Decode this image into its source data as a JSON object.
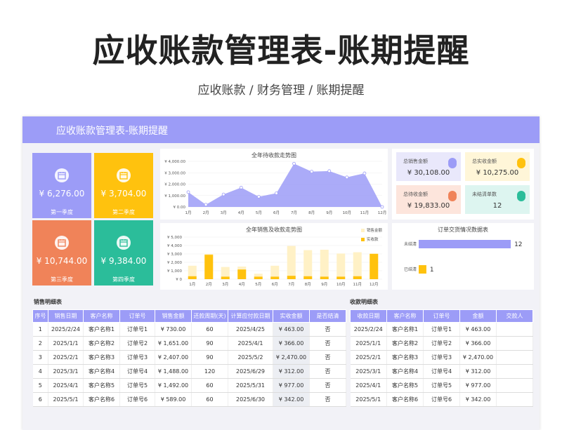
{
  "title": "应收账款管理表-账期提醒",
  "subtitle": "应收账款 / 财务管理 / 账期提醒",
  "banner_title": "应收账款管理表-账期提醒",
  "colors": {
    "accent": "#9c9cf7",
    "yellow": "#ffc20e",
    "orange": "#f08359",
    "teal": "#2bbd9a"
  },
  "quarters": [
    {
      "amount": "¥ 6,276.00",
      "label": "第一季度",
      "color": "#9c9cf7",
      "icon": "calendar-icon"
    },
    {
      "amount": "¥ 3,704.00",
      "label": "第二季度",
      "color": "#ffc20e",
      "icon": "calendar-icon"
    },
    {
      "amount": "¥ 10,744.00",
      "label": "第三季度",
      "color": "#f08359",
      "icon": "calendar-icon"
    },
    {
      "amount": "¥ 9,384.00",
      "label": "第四季度",
      "color": "#2bbd9a",
      "icon": "calendar-icon"
    }
  ],
  "kpis": [
    {
      "label": "总销售金额",
      "value": "¥ 30,108.00",
      "bg": "#e9e8fb",
      "coin": "#9c9cf7",
      "icon": "coins-icon"
    },
    {
      "label": "总实收金额",
      "value": "¥ 10,275.00",
      "bg": "#fff6d8",
      "coin": "#ffc20e",
      "icon": "coins-icon"
    },
    {
      "label": "总待收金额",
      "value": "¥ 19,833.00",
      "bg": "#fde5dc",
      "coin": "#f08359",
      "icon": "coins-icon"
    },
    {
      "label": "未结清单数",
      "value": "12",
      "bg": "#ddf5f0",
      "coin": "#2bbd9a",
      "icon": "coins-icon"
    }
  ],
  "chart_data": [
    {
      "type": "area",
      "title": "全年待收款走势图",
      "categories": [
        "1月",
        "2月",
        "3月",
        "4月",
        "5月",
        "6月",
        "7月",
        "8月",
        "9月",
        "10月",
        "11月",
        "12月"
      ],
      "yticks": [
        "¥ 4,000.00",
        "¥ 3,000.00",
        "¥ 2,000.00",
        "¥ 1,000.00",
        "¥ 0.00"
      ],
      "ylim": [
        0,
        4000
      ],
      "values": [
        1300,
        200,
        1100,
        1700,
        900,
        1200,
        3800,
        3100,
        3150,
        2600,
        2950,
        0
      ],
      "color": "#9c9cf7"
    },
    {
      "type": "bar",
      "title": "全年销售及收款走势图",
      "categories": [
        "1月",
        "2月",
        "3月",
        "4月",
        "5月",
        "6月",
        "7月",
        "8月",
        "9月",
        "10月",
        "11月",
        "12月"
      ],
      "yticks": [
        "¥ 5,000",
        "¥ 4,000",
        "¥ 3,000",
        "¥ 2,000",
        "¥ 1,000",
        "¥ 0"
      ],
      "ylim": [
        0,
        5000
      ],
      "series": [
        {
          "name": "销售金额",
          "values": [
            1600,
            3000,
            1450,
            1500,
            650,
            1600,
            3950,
            3450,
            3500,
            3050,
            3200,
            3100
          ],
          "color": "#fff1c6"
        },
        {
          "name": "实收款",
          "values": [
            350,
            2900,
            300,
            1150,
            300,
            300,
            400,
            350,
            300,
            300,
            350,
            3000
          ],
          "color": "#ffc20e"
        }
      ]
    },
    {
      "type": "bar",
      "title": "订单交货情况数据表",
      "categories": [
        "未结清",
        "已结清"
      ],
      "values": [
        12,
        1
      ],
      "xlim": [
        0,
        13
      ],
      "colors": [
        "#9c9cf7",
        "#ffc20e"
      ]
    }
  ],
  "sales_table": {
    "title": "销售明细表",
    "headers": [
      "序号",
      "销售日期",
      "客户名称",
      "订单号",
      "销售金额",
      "还款周期(天)",
      "计算应付款日期",
      "实收金额",
      "是否结清"
    ],
    "rows": [
      [
        "1",
        "2025/2/24",
        "客户名称1",
        "订单号1",
        "¥ 730.00",
        "60",
        "2025/4/25",
        "¥ 463.00",
        "否"
      ],
      [
        "2",
        "2025/1/1",
        "客户名称2",
        "订单号2",
        "¥ 1,651.00",
        "90",
        "2025/4/1",
        "¥ 366.00",
        "否"
      ],
      [
        "3",
        "2025/2/1",
        "客户名称3",
        "订单号3",
        "¥ 2,407.00",
        "90",
        "2025/5/2",
        "¥ 2,470.00",
        "否"
      ],
      [
        "4",
        "2025/3/1",
        "客户名称4",
        "订单号4",
        "¥ 1,488.00",
        "120",
        "2025/6/29",
        "¥ 312.00",
        "否"
      ],
      [
        "5",
        "2025/4/1",
        "客户名称5",
        "订单号5",
        "¥ 1,492.00",
        "60",
        "2025/5/31",
        "¥ 977.00",
        "否"
      ],
      [
        "6",
        "2025/5/1",
        "客户名称6",
        "订单号6",
        "¥ 589.00",
        "60",
        "2025/6/30",
        "¥ 342.00",
        "否"
      ]
    ]
  },
  "receipt_table": {
    "title": "收款明细表",
    "headers": [
      "收款日期",
      "客户名称",
      "订单号",
      "金额",
      "交款人"
    ],
    "rows": [
      [
        "2025/2/24",
        "客户名称1",
        "订单号1",
        "¥ 463.00",
        ""
      ],
      [
        "2025/1/1",
        "客户名称2",
        "订单号2",
        "¥ 366.00",
        ""
      ],
      [
        "2025/2/1",
        "客户名称3",
        "订单号3",
        "¥ 2,470.00",
        ""
      ],
      [
        "2025/3/1",
        "客户名称4",
        "订单号4",
        "¥ 312.00",
        ""
      ],
      [
        "2025/4/1",
        "客户名称5",
        "订单号5",
        "¥ 977.00",
        ""
      ],
      [
        "2025/5/1",
        "客户名称6",
        "订单号6",
        "¥ 342.00",
        ""
      ]
    ]
  }
}
